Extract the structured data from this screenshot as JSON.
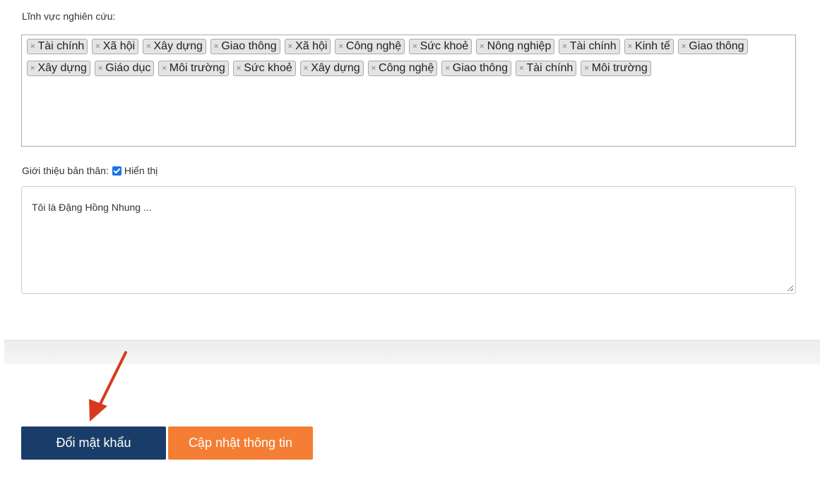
{
  "research": {
    "label": "Lĩnh vực nghiên cứu:",
    "remove_glyph": "×",
    "tags": [
      "Tài chính",
      "Xã hội",
      "Xây dựng",
      "Giao thông",
      "Xã hội",
      "Công nghệ",
      "Sức khoẻ",
      "Nông nghiệp",
      "Tài chính",
      "Kinh tế",
      "Giao thông",
      "Xây dựng",
      "Giáo dục",
      "Môi trường",
      "Sức khoẻ",
      "Xây dựng",
      "Công nghệ",
      "Giao thông",
      "Tài chính",
      "Môi trường"
    ]
  },
  "intro": {
    "label": "Giới thiệu bản thân:",
    "show_checked": true,
    "show_label": "Hiển thị",
    "text": "Tôi là Đặng Hồng Nhung ..."
  },
  "buttons": {
    "change_password": "Đổi mật khẩu",
    "update_info": "Cập nhật thông tin"
  },
  "colors": {
    "primary": "#1a3c68",
    "accent": "#f47e33",
    "annotation_arrow": "#d63a1e"
  }
}
